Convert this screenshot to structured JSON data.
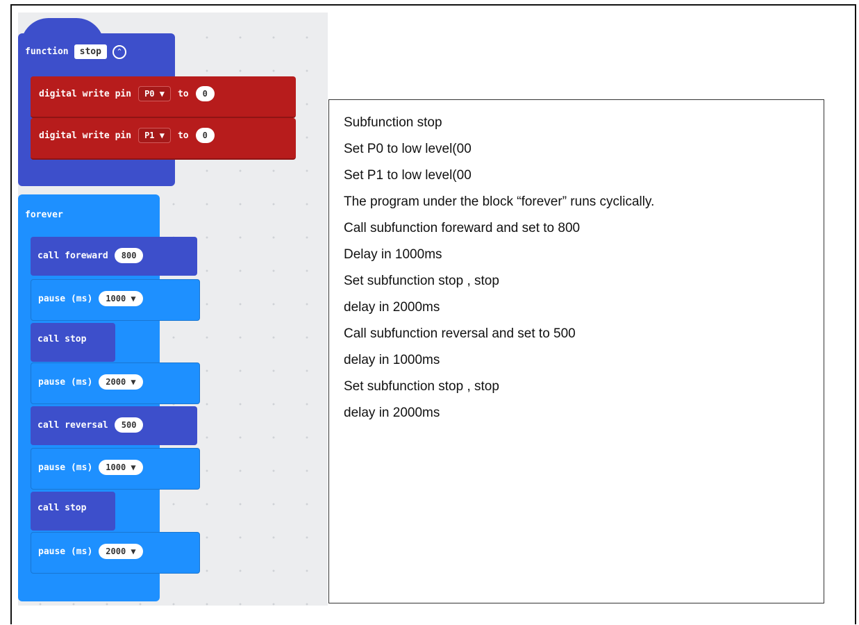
{
  "blocks": {
    "function_block": {
      "keyword": "function",
      "name": "stop"
    },
    "digital_writes": [
      {
        "label": "digital write pin",
        "pin": "P0 ▼",
        "to": "to",
        "value": "0"
      },
      {
        "label": "digital write pin",
        "pin": "P1 ▼",
        "to": "to",
        "value": "0"
      }
    ],
    "forever": {
      "label": "forever",
      "steps": [
        {
          "text": "call foreward",
          "value": "800"
        },
        {
          "text": "pause (ms)",
          "value": "1000 ▼"
        },
        {
          "text": "call stop"
        },
        {
          "text": "pause (ms)",
          "value": "2000 ▼"
        },
        {
          "text": "call reversal",
          "value": "500"
        },
        {
          "text": "pause (ms)",
          "value": "1000 ▼"
        },
        {
          "text": "call stop"
        },
        {
          "text": "pause (ms)",
          "value": "2000 ▼"
        }
      ]
    }
  },
  "notes": [
    "Subfunction stop",
    "Set P0 to low level(00",
    "Set P1 to low level(00",
    "The program under the block “forever” runs cyclically.",
    "Call subfunction foreward and set to 800",
    "Delay in 1000ms",
    "Set subfunction stop , stop",
    "delay in 2000ms",
    "Call subfunction reversal and set to 500",
    "delay in 1000ms",
    "Set subfunction stop , stop",
    "delay in 2000ms"
  ],
  "colors": {
    "function_block": "#3d4fcb",
    "pin_block": "#b71c1c",
    "forever_block": "#1e90ff",
    "call_block": "#3d4fcb",
    "pause_block": "#1e90ff"
  }
}
